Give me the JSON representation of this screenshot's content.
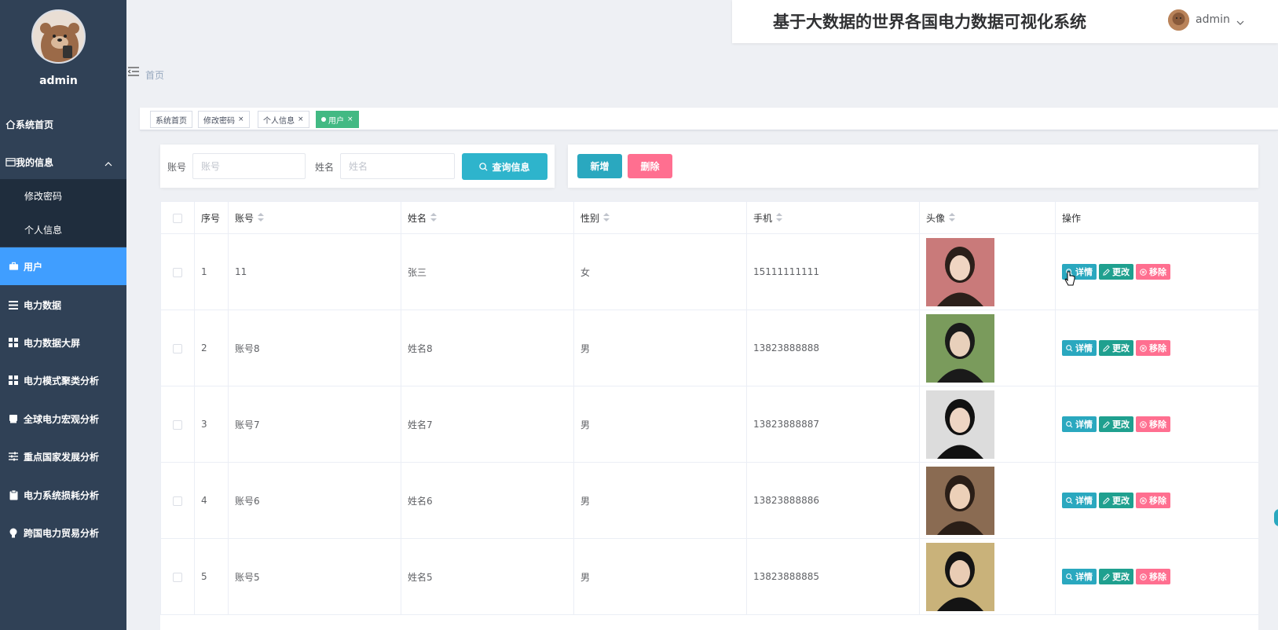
{
  "app": {
    "title": "基于大数据的世界各国电力数据可视化系统",
    "user": "admin"
  },
  "sidebar": {
    "username": "admin",
    "items": [
      {
        "label": "系统首页",
        "icon": "home-icon"
      },
      {
        "label": "我的信息",
        "icon": "window-icon",
        "expanded": true,
        "children": [
          "修改密码",
          "个人信息"
        ]
      },
      {
        "label": "用户",
        "icon": "briefcase-icon",
        "active": true
      },
      {
        "label": "电力数据",
        "icon": "list-icon"
      },
      {
        "label": "电力数据大屏",
        "icon": "grid-icon"
      },
      {
        "label": "电力模式聚类分析",
        "icon": "grid-icon"
      },
      {
        "label": "全球电力宏观分析",
        "icon": "printer-icon"
      },
      {
        "label": "重点国家发展分析",
        "icon": "sliders-icon"
      },
      {
        "label": "电力系统损耗分析",
        "icon": "clipboard-icon"
      },
      {
        "label": "跨国电力贸易分析",
        "icon": "bulb-icon"
      }
    ]
  },
  "breadcrumb": "首页",
  "tags": [
    {
      "label": "系统首页",
      "closable": false
    },
    {
      "label": "修改密码",
      "closable": true
    },
    {
      "label": "个人信息",
      "closable": true
    },
    {
      "label": "用户",
      "closable": true,
      "active": true
    }
  ],
  "tag_close": "×",
  "search": {
    "account_label": "账号",
    "account_placeholder": "账号",
    "name_label": "姓名",
    "name_placeholder": "姓名",
    "query_label": "查询信息"
  },
  "actions": {
    "add_label": "新增",
    "delete_label": "删除"
  },
  "table": {
    "columns": [
      "序号",
      "账号",
      "姓名",
      "性别",
      "手机",
      "头像",
      "操作"
    ],
    "op_labels": {
      "detail": "详情",
      "edit": "更改",
      "remove": "移除"
    },
    "rows": [
      {
        "index": "1",
        "account": "11",
        "name": "张三",
        "gender": "女",
        "phone": "15111111111"
      },
      {
        "index": "2",
        "account": "账号8",
        "name": "姓名8",
        "gender": "男",
        "phone": "13823888888"
      },
      {
        "index": "3",
        "account": "账号7",
        "name": "姓名7",
        "gender": "男",
        "phone": "13823888887"
      },
      {
        "index": "4",
        "account": "账号6",
        "name": "姓名6",
        "gender": "男",
        "phone": "13823888886"
      },
      {
        "index": "5",
        "account": "账号5",
        "name": "姓名5",
        "gender": "男",
        "phone": "13823888885"
      }
    ]
  },
  "colors": {
    "sidebar_bg": "#304156",
    "active_menu": "#409eff",
    "tag_active": "#42b983",
    "btn_primary": "#2aa8bf",
    "btn_danger": "#ff6f90",
    "btn_edit": "#1fa08f"
  }
}
